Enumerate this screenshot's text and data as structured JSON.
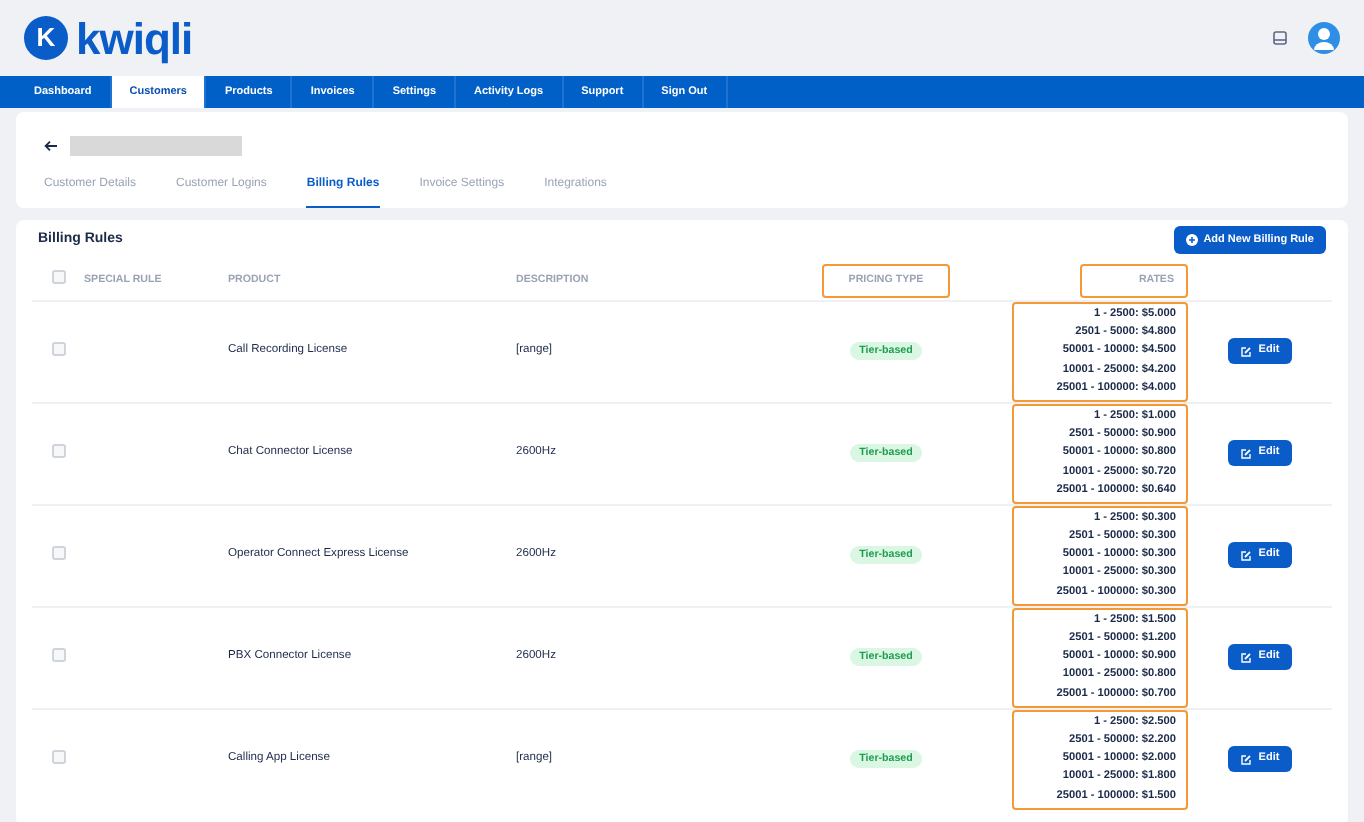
{
  "brand": {
    "name": "kwiqli",
    "logo_letter": "K"
  },
  "nav": [
    {
      "label": "Dashboard",
      "selected": false
    },
    {
      "label": "Customers",
      "selected": true
    },
    {
      "label": "Products",
      "selected": false
    },
    {
      "label": "Invoices",
      "selected": false
    },
    {
      "label": "Settings",
      "selected": false
    },
    {
      "label": "Activity Logs",
      "selected": false
    },
    {
      "label": "Support",
      "selected": false
    },
    {
      "label": "Sign Out",
      "selected": false
    }
  ],
  "customer_tabs": [
    {
      "label": "Customer Details",
      "selected": false
    },
    {
      "label": "Customer Logins",
      "selected": false
    },
    {
      "label": "Billing Rules",
      "selected": true
    },
    {
      "label": "Invoice Settings",
      "selected": false
    },
    {
      "label": "Integrations",
      "selected": false
    }
  ],
  "billing": {
    "title": "Billing Rules",
    "add_button": "Add New Billing Rule",
    "header_checked": false,
    "columns": [
      {
        "kind": "check",
        "highlighted": false
      },
      {
        "label": "SPECIAL RULE",
        "kind": "text",
        "highlighted": false
      },
      {
        "label": "PRODUCT",
        "kind": "text",
        "highlighted": false
      },
      {
        "label": "DESCRIPTION",
        "kind": "text",
        "highlighted": false
      },
      {
        "label": "PRICING TYPE",
        "kind": "pill",
        "highlighted": true
      },
      {
        "label": "RATES",
        "kind": "rates",
        "highlighted": true
      },
      {
        "kind": "action",
        "highlighted": false
      }
    ],
    "rows": [
      {
        "checked": false,
        "product": "Call Recording License",
        "description": "[range]",
        "pricing_type": "Tier-based",
        "rates": [
          "1 - 2500: $5.000",
          "2501 - 5000: $4.800",
          "50001 - 10000: $4.500",
          "10001 - 25000: $4.200",
          "25001 - 100000: $4.000"
        ],
        "action": "Edit"
      },
      {
        "checked": false,
        "product": "Chat Connector License",
        "description": "2600Hz",
        "pricing_type": "Tier-based",
        "rates": [
          "1 - 2500: $1.000",
          "2501 - 50000: $0.900",
          "50001 - 10000: $0.800",
          "10001 - 25000: $0.720",
          "25001 - 100000: $0.640"
        ],
        "action": "Edit"
      },
      {
        "checked": false,
        "product": "Operator Connect Express License",
        "description": "2600Hz",
        "pricing_type": "Tier-based",
        "rates": [
          "1 - 2500: $0.300",
          "2501 - 50000: $0.300",
          "50001 - 10000: $0.300",
          "10001 - 25000: $0.300",
          "25001 - 100000: $0.300"
        ],
        "action": "Edit"
      },
      {
        "checked": false,
        "product": "PBX Connector License",
        "description": "2600Hz",
        "pricing_type": "Tier-based",
        "rates": [
          "1 - 2500: $1.500",
          "2501 - 50000: $1.200",
          "50001 - 10000: $0.900",
          "10001 - 25000: $0.800",
          "25001 - 100000: $0.700"
        ],
        "action": "Edit"
      },
      {
        "checked": false,
        "product": "Calling App License",
        "description": "[range]",
        "pricing_type": "Tier-based",
        "rates": [
          "1 - 2500: $2.500",
          "2501 - 50000: $2.200",
          "50001 - 10000: $2.000",
          "10001 - 25000: $1.800",
          "25001 - 100000: $1.500"
        ],
        "action": "Edit"
      }
    ]
  }
}
